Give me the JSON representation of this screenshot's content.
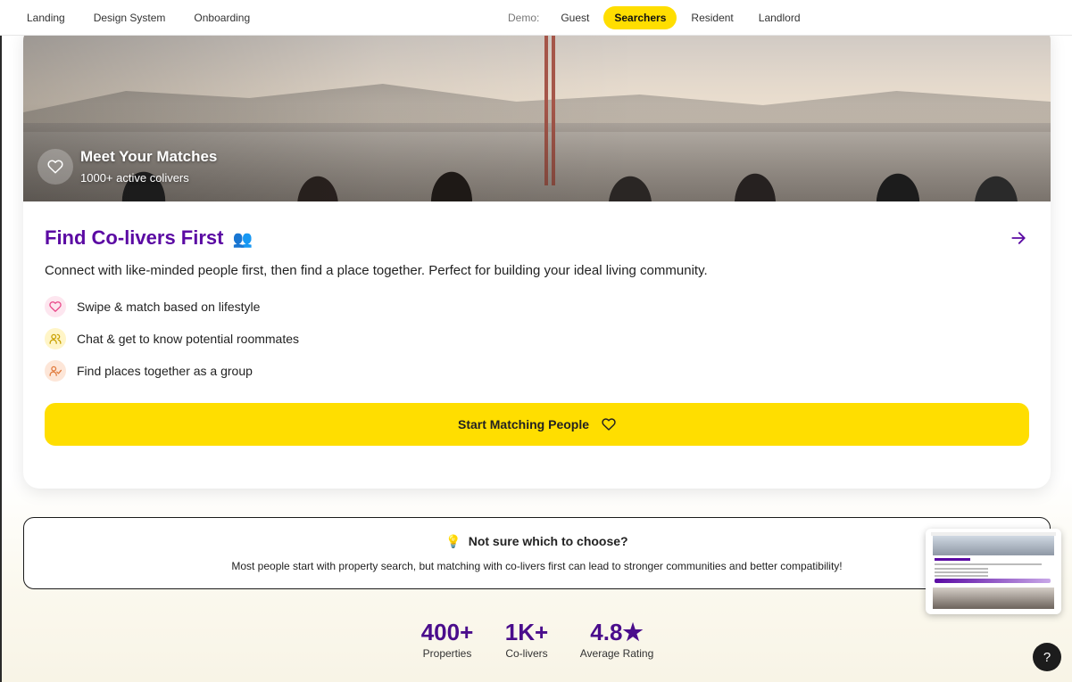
{
  "nav": {
    "links": [
      "Landing",
      "Design System",
      "Onboarding"
    ],
    "demo_label": "Demo:",
    "demo_options": [
      "Guest",
      "Searchers",
      "Resident",
      "Landlord"
    ],
    "demo_active": "Searchers"
  },
  "hero": {
    "title": "Meet Your Matches",
    "subtitle": "1000+ active colivers"
  },
  "card": {
    "title": "Find Co-livers First",
    "title_emoji": "👥",
    "description": "Connect with like-minded people first, then find a place together. Perfect for building your ideal living community.",
    "features": [
      {
        "label": "Swipe & match based on lifestyle",
        "icon": "heart-icon",
        "color": "#e94a8a",
        "bg": "#fde6ef"
      },
      {
        "label": "Chat & get to know potential roommates",
        "icon": "users-icon",
        "color": "#c9a100",
        "bg": "#fff5c7"
      },
      {
        "label": "Find places together as a group",
        "icon": "user-check-icon",
        "color": "#e07a3c",
        "bg": "#fde6d8"
      }
    ],
    "cta_label": "Start Matching People"
  },
  "help": {
    "icon": "💡",
    "title": "Not sure which to choose?",
    "text": "Most people start with property search, but matching with co-livers first can lead to stronger communities and better compatibility!"
  },
  "stats": [
    {
      "value": "400+",
      "label": "Properties"
    },
    {
      "value": "1K+",
      "label": "Co-livers"
    },
    {
      "value": "4.8★",
      "label": "Average Rating"
    }
  ],
  "help_fab": "?",
  "colors": {
    "accent_yellow": "#ffde00",
    "brand_purple": "#5b0aa3"
  }
}
